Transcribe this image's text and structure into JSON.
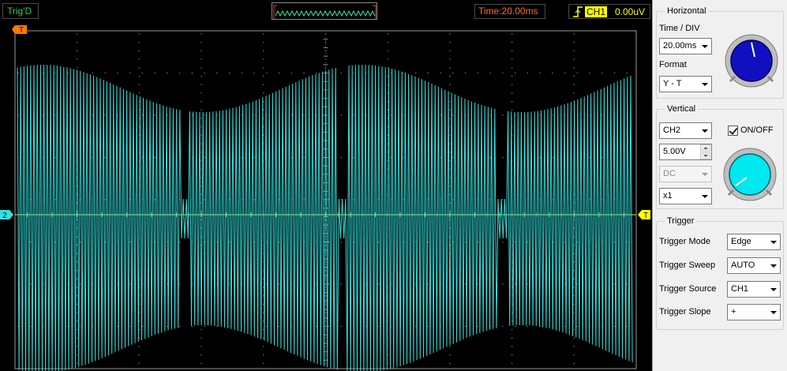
{
  "topbar": {
    "trigger_status": "Trig'D",
    "time_label": "Time:20.00ms",
    "trigger_channel": "CH1",
    "trigger_level": "0.00uV"
  },
  "scope": {
    "ch2_marker": "2",
    "trigger_position_marker": "T",
    "trigger_level_marker": "T",
    "trace_color": "#33e0e0",
    "ch1_color": "#b8ff30",
    "grid_color": "#8a8a8a"
  },
  "panel": {
    "horizontal": {
      "title": "Horizontal",
      "time_div_label": "Time / DIV",
      "time_div_value": "20.00ms",
      "format_label": "Format",
      "format_value": "Y - T",
      "knob_color": "#1010c0"
    },
    "vertical": {
      "title": "Vertical",
      "channel_value": "CH2",
      "onoff_label": "ON/OFF",
      "onoff_checked": true,
      "volts_value": "5.00V",
      "coupling_value": "DC",
      "probe_value": "x1",
      "knob_color": "#00e8f0"
    },
    "trigger": {
      "title": "Trigger",
      "mode_label": "Trigger Mode",
      "mode_value": "Edge",
      "sweep_label": "Trigger Sweep",
      "sweep_value": "AUTO",
      "source_label": "Trigger Source",
      "source_value": "CH1",
      "slope_label": "Trigger Slope",
      "slope_value": "+"
    }
  }
}
